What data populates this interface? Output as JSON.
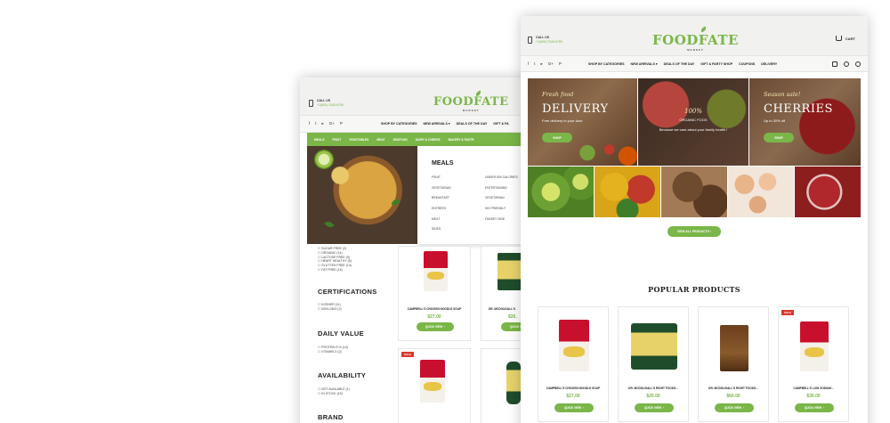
{
  "back": {
    "contact": {
      "label": "CALL US",
      "phone": "+1(800) 2345-6789"
    },
    "logo": {
      "name": "FOODFATE",
      "sub": "MARKET"
    },
    "social_icons": [
      "facebook-icon",
      "twitter-icon",
      "youtube-icon",
      "google-plus-icon",
      "pinterest-icon"
    ],
    "menu": [
      "SHOP BY CATEGORIES",
      "NEW ARRIVALS ▾",
      "DEALS OF THE DAY",
      "GIFT & PA"
    ],
    "categories": [
      "MEALS",
      "FRUIT",
      "VEGETABLES",
      "MEAT",
      "SEAFOOD",
      "DAIRY & CHEESE",
      "BAKERY & PASTR"
    ],
    "mega": {
      "title": "MEALS",
      "col1": [
        "FRUIT",
        "VEGETARIAN",
        "BREAKFAST",
        "ENTRÉES",
        "MEAT",
        "SIDES"
      ],
      "col2": [
        "UNDER 500 CALORIES",
        "ENTERTAINING",
        "VEGETARIAN",
        "KID FRIENDLY",
        "FANSEY SIDE"
      ]
    },
    "filters": {
      "top_list": [
        "SUGAR FREE (2)",
        "ORGANIC (14)",
        "LACTOSE FREE (5)",
        "HEART HEALTHY (5)",
        "GLUTTEN FREE (14)",
        "FAT FREE (14)"
      ],
      "certifications": {
        "title": "CERTIFICATIONS",
        "items": [
          "KOSHER (11)",
          "NON-GMO (2)"
        ]
      },
      "daily_value": {
        "title": "DAILY VALUE",
        "items": [
          "PROTEIN 5 % (14)",
          "VITAMIN D (2)"
        ]
      },
      "availability": {
        "title": "AVAILABILITY",
        "items": [
          "NOT AVAILABLE (1)",
          "IN STOCK (15)"
        ]
      },
      "brand": {
        "title": "BRAND"
      }
    },
    "products": [
      {
        "name": "CAMPBELL'S CHICKEN NOODLE SOUP",
        "price": "$27.00",
        "button": "QUICK VIEW"
      },
      {
        "name": "DR. MCDOUGALL'S",
        "price": "$20.",
        "button": "QUICK VIEW"
      }
    ],
    "sale_badge": "SALE"
  },
  "front": {
    "contact": {
      "label": "CALL US",
      "phone": "+1(800) 2345-6789"
    },
    "logo": {
      "name": "FOODFATE",
      "sub": "MARKET"
    },
    "cart_label": "CART",
    "social_icons": [
      "facebook-icon",
      "twitter-icon",
      "youtube-icon",
      "google-plus-icon",
      "pinterest-icon"
    ],
    "menu": [
      "SHOP BY CATEGORIES",
      "NEW ARRIVALS ▾",
      "DEALS OF THE DAY",
      "GIFT & PARTY SHOP",
      "COUPONS",
      "DELIVERY"
    ],
    "banners": [
      {
        "pre": "Fresh food",
        "title": "DELIVERY",
        "sub": "Free delivery to your door",
        "button": "SHOP"
      },
      {
        "pre": "100%",
        "title": "ORGANIC FOOD",
        "sub": "Because we care about your family health !",
        "button": "SHOP"
      },
      {
        "pre": "Season sale!",
        "title": "CHERRIES",
        "sub": "Up to 30% off",
        "button": "SHOP"
      }
    ],
    "view_all": "VIEW ALL PRODUCTS",
    "popular_title": "POPULAR PRODUCTS",
    "sale_badge": "SALE",
    "products": [
      {
        "name": "CAMPBELL'S CHICKEN NOODLE SOUP",
        "price": "$27.00",
        "button": "QUICK VIEW"
      },
      {
        "name": "DR. MCDOUGALL'S RIGHT FOODS...",
        "price": "$20.00",
        "button": "QUICK VIEW"
      },
      {
        "name": "DR. MCDOUGALL'S RIGHT FOODS...",
        "price": "$60.00",
        "button": "QUICK VIEW"
      },
      {
        "name": "CAMPBELL'S LOW SODIUM...",
        "price": "$30.00",
        "button": "QUICK VIEW"
      }
    ]
  },
  "colors": {
    "accent": "#7ab648",
    "sale": "#d9382f",
    "text": "#222222"
  }
}
